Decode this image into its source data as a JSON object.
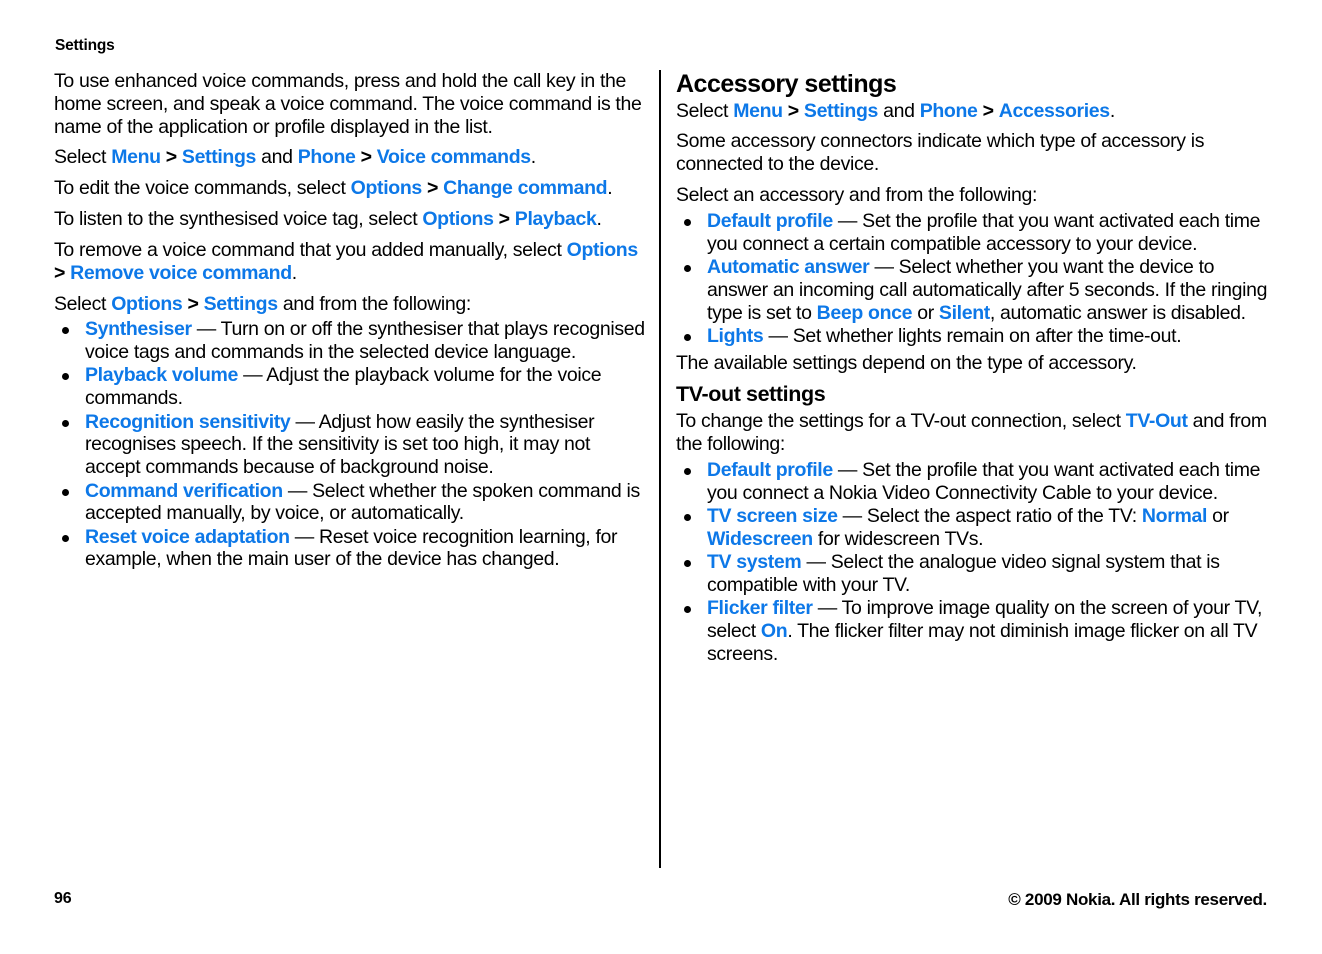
{
  "document": {
    "running_head": "Settings",
    "page_number": "96",
    "copyright": "© 2009 Nokia. All rights reserved."
  },
  "left_column": {
    "intro_paragraph": "To use enhanced voice commands, press and hold the call key in the home screen, and speak a voice command. The voice command is the name of the application or profile displayed in the list.",
    "path_line": {
      "select": "Select",
      "menu": "Menu",
      "sep1": ">",
      "settings": "Settings",
      "and": "and",
      "phone": "Phone",
      "sep2": ">",
      "voice_commands": "Voice commands",
      "period": "."
    },
    "edit_line": {
      "prefix": "To edit the voice commands, select",
      "options": "Options",
      "sep": ">",
      "change_command": "Change command",
      "period": "."
    },
    "listen_line": {
      "prefix": "To listen to the synthesised voice tag, select",
      "options": "Options",
      "sep": ">",
      "playback": "Playback",
      "period": "."
    },
    "remove_line": {
      "prefix": "To remove a voice command that you added manually, select",
      "options": "Options",
      "sep": ">",
      "remove_voice_command": "Remove voice command",
      "period": "."
    },
    "select_line": {
      "select": "Select",
      "options": "Options",
      "sep": ">",
      "settings": "Settings",
      "suffix": "and from the following:"
    },
    "bullets": [
      {
        "term": "Synthesiser",
        "dash": "—",
        "desc": "Turn on or off the synthesiser that plays recognised voice tags and commands in the selected device language."
      },
      {
        "term": "Playback volume",
        "dash": "—",
        "desc": "Adjust the playback volume for the voice commands."
      },
      {
        "term": "Recognition sensitivity",
        "dash": "—",
        "desc": "Adjust how easily the synthesiser recognises speech. If the sensitivity is set too high, it may not accept commands because of background noise."
      },
      {
        "term": "Command verification",
        "dash": "—",
        "desc": "Select whether the spoken command is accepted manually, by voice, or automatically."
      },
      {
        "term": "Reset voice adaptation",
        "dash": "—",
        "desc": "Reset voice recognition learning, for example, when the main user of the device has changed."
      }
    ]
  },
  "right_column": {
    "accessory": {
      "heading": "Accessory settings",
      "path_line": {
        "select": "Select",
        "menu": "Menu",
        "sep1": ">",
        "settings": "Settings",
        "and": "and",
        "phone": "Phone",
        "sep2": ">",
        "accessories": "Accessories",
        "period": "."
      },
      "note": "Some accessory connectors indicate which type of accessory is connected to the device.",
      "lead_in": "Select an accessory and from the following:",
      "bullets": [
        {
          "term": "Default profile",
          "dash": "—",
          "desc": "Set the profile that you want activated each time you connect a certain compatible accessory to your device."
        },
        {
          "term": "Automatic answer",
          "dash": "—",
          "desc_part1": "Select whether you want the device to answer an incoming call automatically after 5 seconds. If the ringing type is set to",
          "beep_once": "Beep once",
          "or": "or",
          "silent": "Silent",
          "desc_part2": ", automatic answer is disabled."
        },
        {
          "term": "Lights",
          "dash": "—",
          "desc": "Set whether lights remain on after the time-out."
        }
      ],
      "closing": "The available settings depend on the type of accessory."
    },
    "tvout": {
      "heading": "TV-out settings",
      "lead_in": {
        "prefix": "To change the settings for a TV-out connection, select",
        "tv_out": "TV-Out",
        "suffix": "and from the following:"
      },
      "bullets": [
        {
          "term": "Default profile",
          "dash": "—",
          "desc": "Set the profile that you want activated each time you connect a Nokia Video Connectivity Cable to your device."
        },
        {
          "term": "TV screen size",
          "dash": "—",
          "desc_part1": "Select the aspect ratio of the TV:",
          "normal": "Normal",
          "or": "or",
          "widescreen": "Widescreen",
          "desc_part2": "for widescreen TVs."
        },
        {
          "term": "TV system",
          "dash": "—",
          "desc": "Select the analogue video signal system that is compatible with your TV."
        },
        {
          "term": "Flicker filter",
          "dash": "—",
          "desc_part1": "To improve image quality on the screen of your TV, select",
          "on": "On",
          "desc_part2": ". The flicker filter may not diminish image flicker on all TV screens."
        }
      ]
    }
  },
  "colors": {
    "link_blue": "#0d78e8",
    "text_black": "#000000",
    "background": "#ffffff"
  }
}
